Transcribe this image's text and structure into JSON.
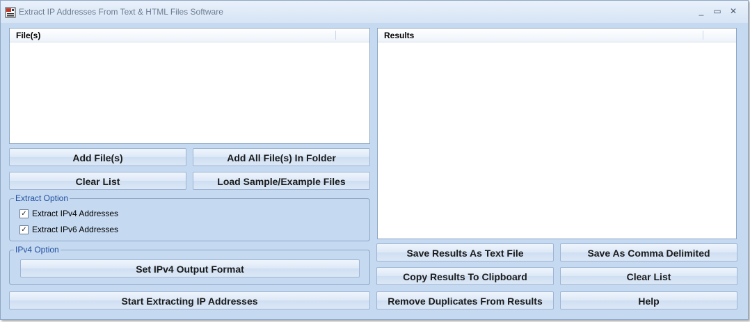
{
  "window": {
    "title": "Extract IP Addresses From Text & HTML Files Software",
    "controls": {
      "minimize": "_",
      "maximize": "▭",
      "close": "✕"
    }
  },
  "files_panel": {
    "header": "File(s)"
  },
  "results_panel": {
    "header": "Results"
  },
  "left_buttons": {
    "add_files": "Add File(s)",
    "add_folder": "Add All File(s) In Folder",
    "clear_list": "Clear List",
    "load_sample": "Load Sample/Example Files"
  },
  "extract_option": {
    "legend": "Extract Option",
    "ipv4": {
      "label": "Extract IPv4 Addresses",
      "checked": true
    },
    "ipv6": {
      "label": "Extract IPv6 Addresses",
      "checked": true
    }
  },
  "ipv4_option": {
    "legend": "IPv4 Option",
    "button": "Set IPv4 Output Format"
  },
  "start_button": "Start Extracting IP Addresses",
  "right_buttons": {
    "save_text": "Save Results As Text File",
    "save_comma": "Save As Comma Delimited",
    "copy_clipboard": "Copy Results To Clipboard",
    "clear_list": "Clear List",
    "remove_duplicates": "Remove Duplicates From Results",
    "help": "Help"
  },
  "check_glyph": "✓",
  "colors": {
    "window_bg": "#c5d9f1",
    "legend_text": "#1f4e9e",
    "border": "#8ea6c4"
  }
}
